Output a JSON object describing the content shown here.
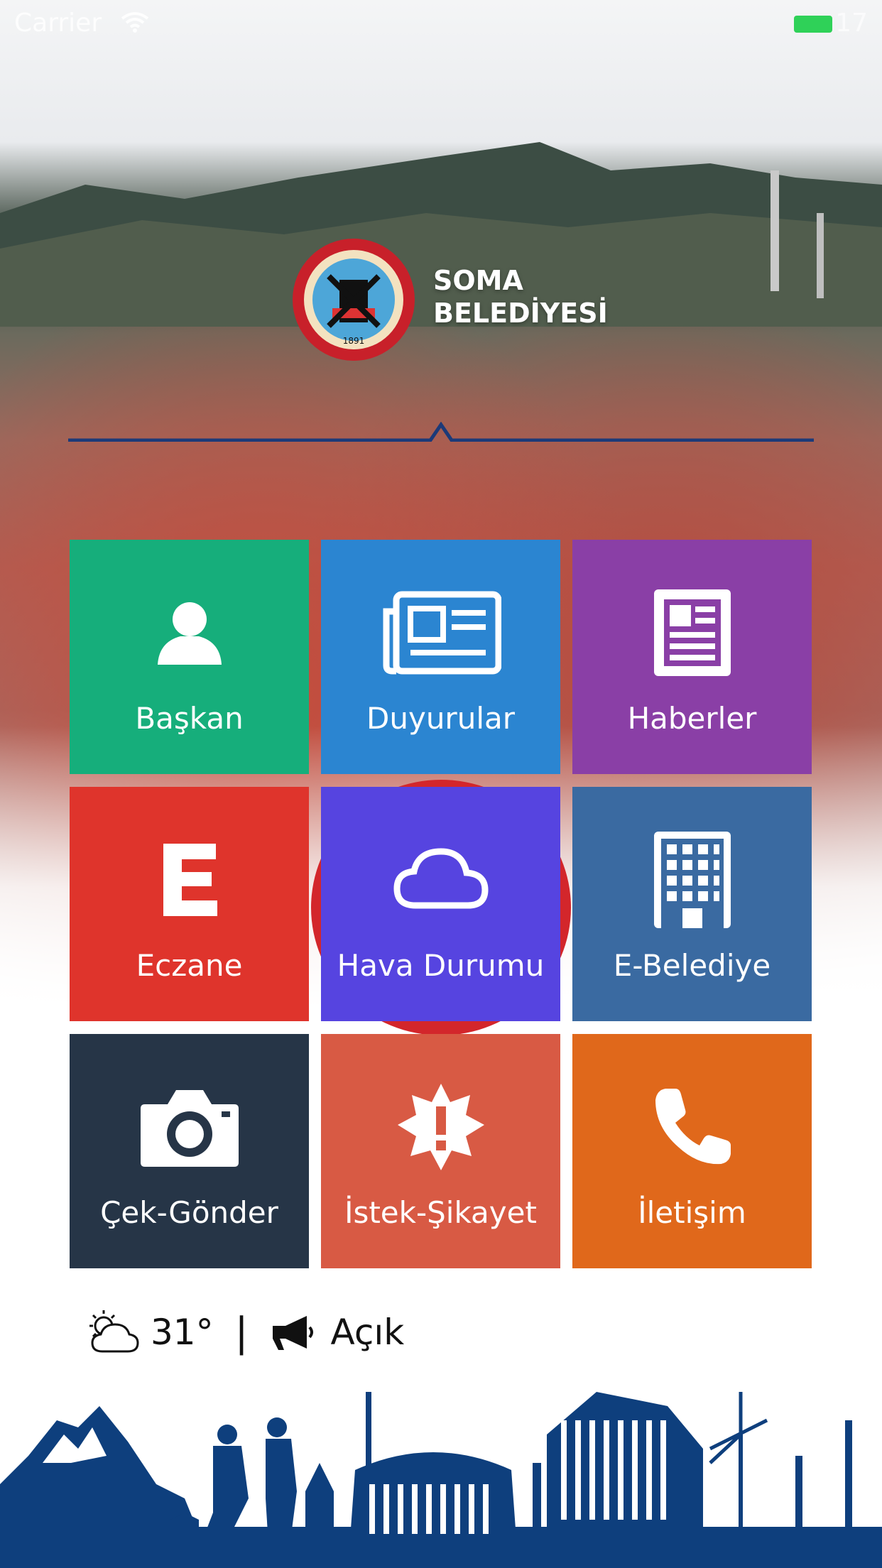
{
  "status_bar": {
    "carrier": "Carrier",
    "battery": "17"
  },
  "brand": {
    "line1": "SOMA",
    "line2": "BELEDİYESİ",
    "seal_year": "1891",
    "seal_text": "SOMA BELEDİYESİ"
  },
  "tiles": [
    {
      "label": "Başkan",
      "icon": "person-icon",
      "color": "#16ae7b"
    },
    {
      "label": "Duyurular",
      "icon": "newspaper-icon",
      "color": "#2b85d1"
    },
    {
      "label": "Haberler",
      "icon": "article-icon",
      "color": "#8a3fa6"
    },
    {
      "label": "Eczane",
      "icon": "pharmacy-e-icon",
      "color": "#df342c"
    },
    {
      "label": "Hava Durumu",
      "icon": "cloud-icon",
      "color": "#5644e0"
    },
    {
      "label": "E-Belediye",
      "icon": "building-icon",
      "color": "#3a6aa1"
    },
    {
      "label": "Çek-Gönder",
      "icon": "camera-icon",
      "color": "#263547"
    },
    {
      "label": "İstek-Şikayet",
      "icon": "alert-badge-icon",
      "color": "#d85a44"
    },
    {
      "label": "İletişim",
      "icon": "phone-icon",
      "color": "#e0681b"
    }
  ],
  "weather": {
    "temperature": "31°",
    "separator": "|",
    "status": "Açık",
    "icon": "partly-cloudy-icon",
    "announce_icon": "megaphone-icon"
  },
  "colors": {
    "skyline": "#0e3f7d",
    "divider": "#1c3a78"
  }
}
